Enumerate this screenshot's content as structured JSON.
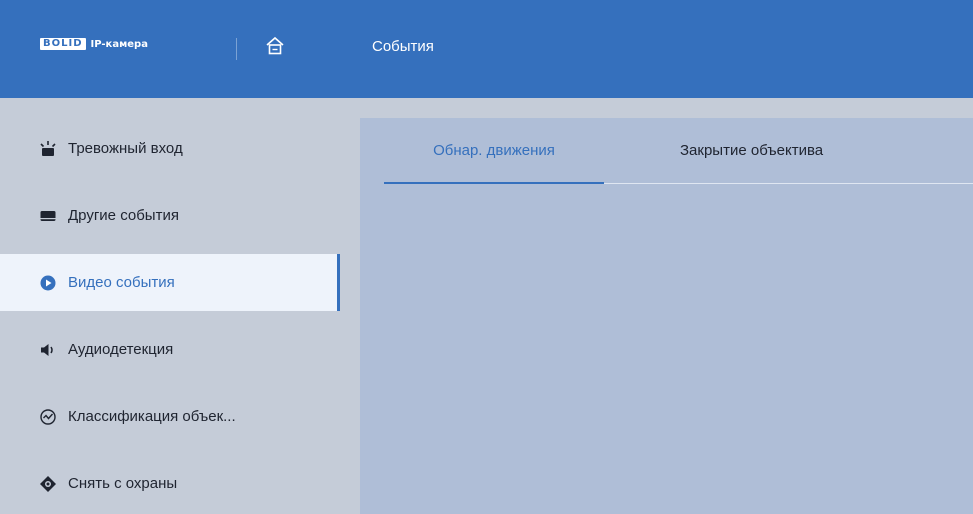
{
  "header": {
    "logo_badge": "BOLID",
    "logo_text": "IP-камера",
    "title": "События",
    "home_icon": "home-icon"
  },
  "sidebar": {
    "items": [
      {
        "label": "Тревожный вход",
        "icon": "alarm-light-icon",
        "active": false
      },
      {
        "label": "Другие события",
        "icon": "drive-icon",
        "active": false
      },
      {
        "label": "Видео события",
        "icon": "play-circle-icon",
        "active": true
      },
      {
        "label": "Аудиодетекция",
        "icon": "speaker-icon",
        "active": false
      },
      {
        "label": "Классификация объек...",
        "icon": "classify-icon",
        "active": false
      },
      {
        "label": "Снять с охраны",
        "icon": "disarm-icon",
        "active": false
      }
    ]
  },
  "main": {
    "tabs": [
      {
        "label": "Обнар. движения",
        "active": true
      },
      {
        "label": "Закрытие объектива",
        "active": false
      }
    ]
  },
  "colors": {
    "accent": "#3570bd",
    "sidebar_bg": "#c5ccd8",
    "content_bg": "#afbed7",
    "active_item_bg": "#eef3fb"
  }
}
